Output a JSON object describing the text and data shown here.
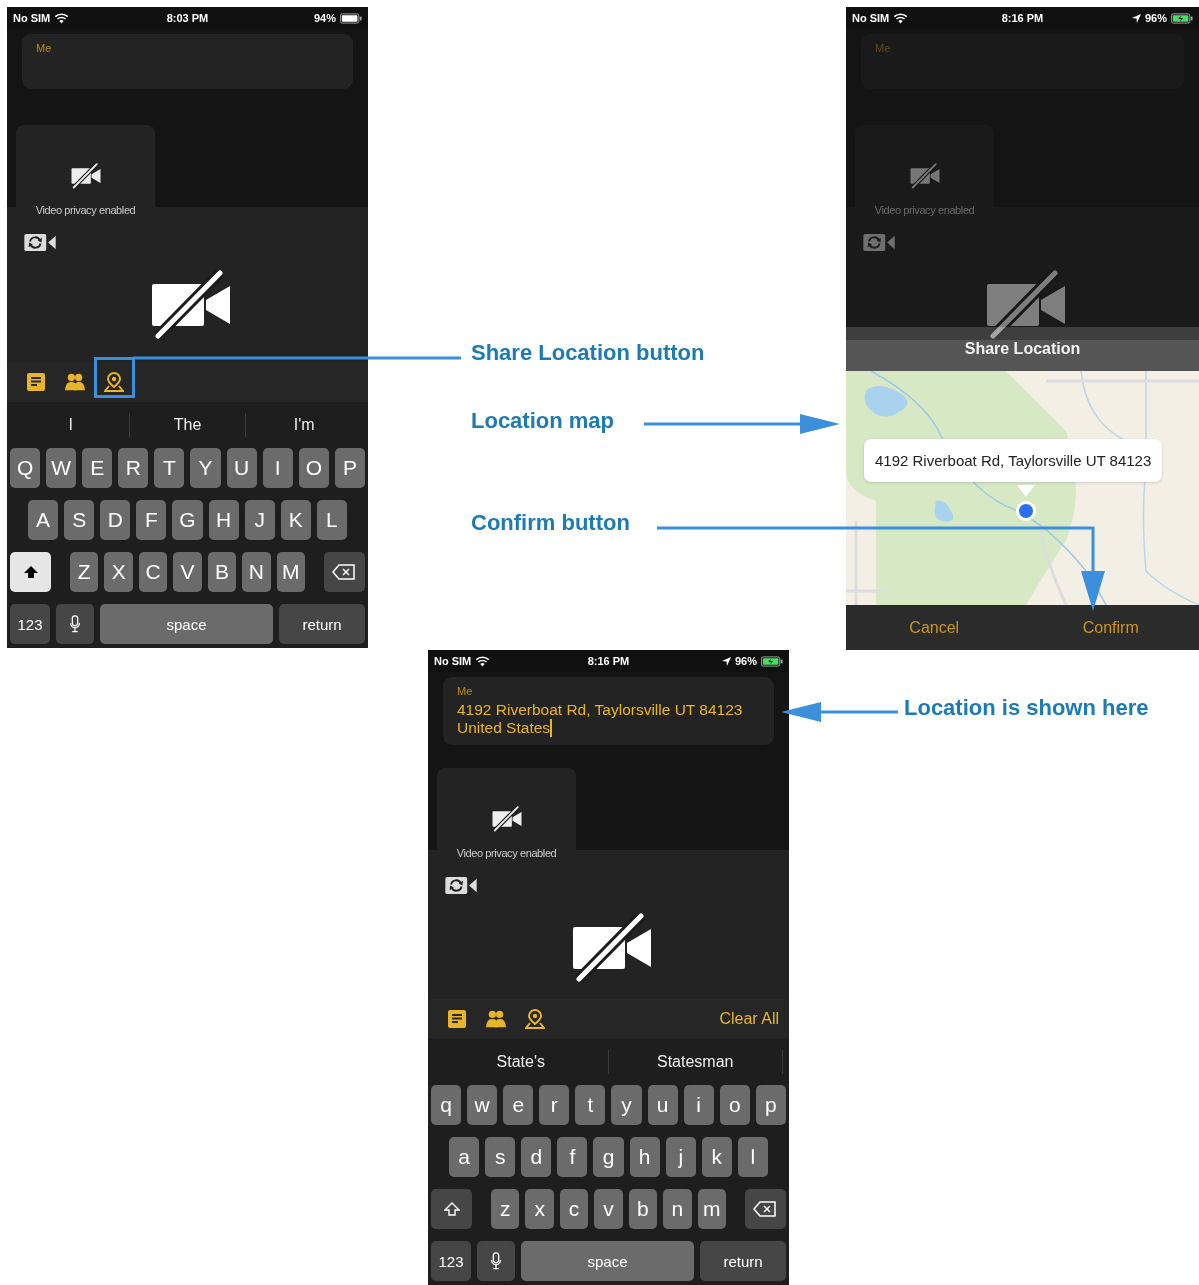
{
  "screens": [
    {
      "kind": "compose",
      "status": {
        "carrier": "No SIM",
        "time": "8:03 PM",
        "battery": "94%",
        "location": false,
        "charging": false
      },
      "message": {
        "label": "Me"
      },
      "privacy_text": "Video privacy enabled",
      "suggestions": [
        "I",
        "The",
        "I'm"
      ],
      "keyboard": {
        "rows": [
          [
            "Q",
            "W",
            "E",
            "R",
            "T",
            "Y",
            "U",
            "I",
            "O",
            "P"
          ],
          [
            "A",
            "S",
            "D",
            "F",
            "G",
            "H",
            "J",
            "K",
            "L"
          ],
          [
            "Z",
            "X",
            "C",
            "V",
            "B",
            "N",
            "M"
          ]
        ],
        "shift_on": true,
        "numbers": "123",
        "space": "space",
        "return": "return"
      }
    },
    {
      "kind": "share_location",
      "status": {
        "carrier": "No SIM",
        "time": "8:16 PM",
        "battery": "96%",
        "location": true,
        "charging": true
      },
      "message": {
        "label": "Me"
      },
      "privacy_text": "Video privacy enabled",
      "sheet": {
        "title": "Share Location",
        "address": "4192 Riverboat Rd, Taylorsville UT 84123",
        "buttons": [
          "Cancel",
          "Confirm"
        ]
      }
    },
    {
      "kind": "compose",
      "status": {
        "carrier": "No SIM",
        "time": "8:16 PM",
        "battery": "96%",
        "location": true,
        "charging": true
      },
      "message": {
        "label": "Me",
        "lines": [
          "4192 Riverboat Rd, Taylorsville UT 84123",
          "United States"
        ]
      },
      "privacy_text": "Video privacy enabled",
      "toolbar_action": "Clear All",
      "suggestions": [
        "State's",
        "Statesman"
      ],
      "keyboard": {
        "rows": [
          [
            "q",
            "w",
            "e",
            "r",
            "t",
            "y",
            "u",
            "i",
            "o",
            "p"
          ],
          [
            "a",
            "s",
            "d",
            "f",
            "g",
            "h",
            "j",
            "k",
            "l"
          ],
          [
            "z",
            "x",
            "c",
            "v",
            "b",
            "n",
            "m"
          ]
        ],
        "shift_on": false,
        "numbers": "123",
        "space": "space",
        "return": "return"
      }
    }
  ],
  "annotations": [
    {
      "label": "Share Location button"
    },
    {
      "label": "Location map"
    },
    {
      "label": "Confirm button"
    },
    {
      "label": "Location is shown here"
    }
  ]
}
